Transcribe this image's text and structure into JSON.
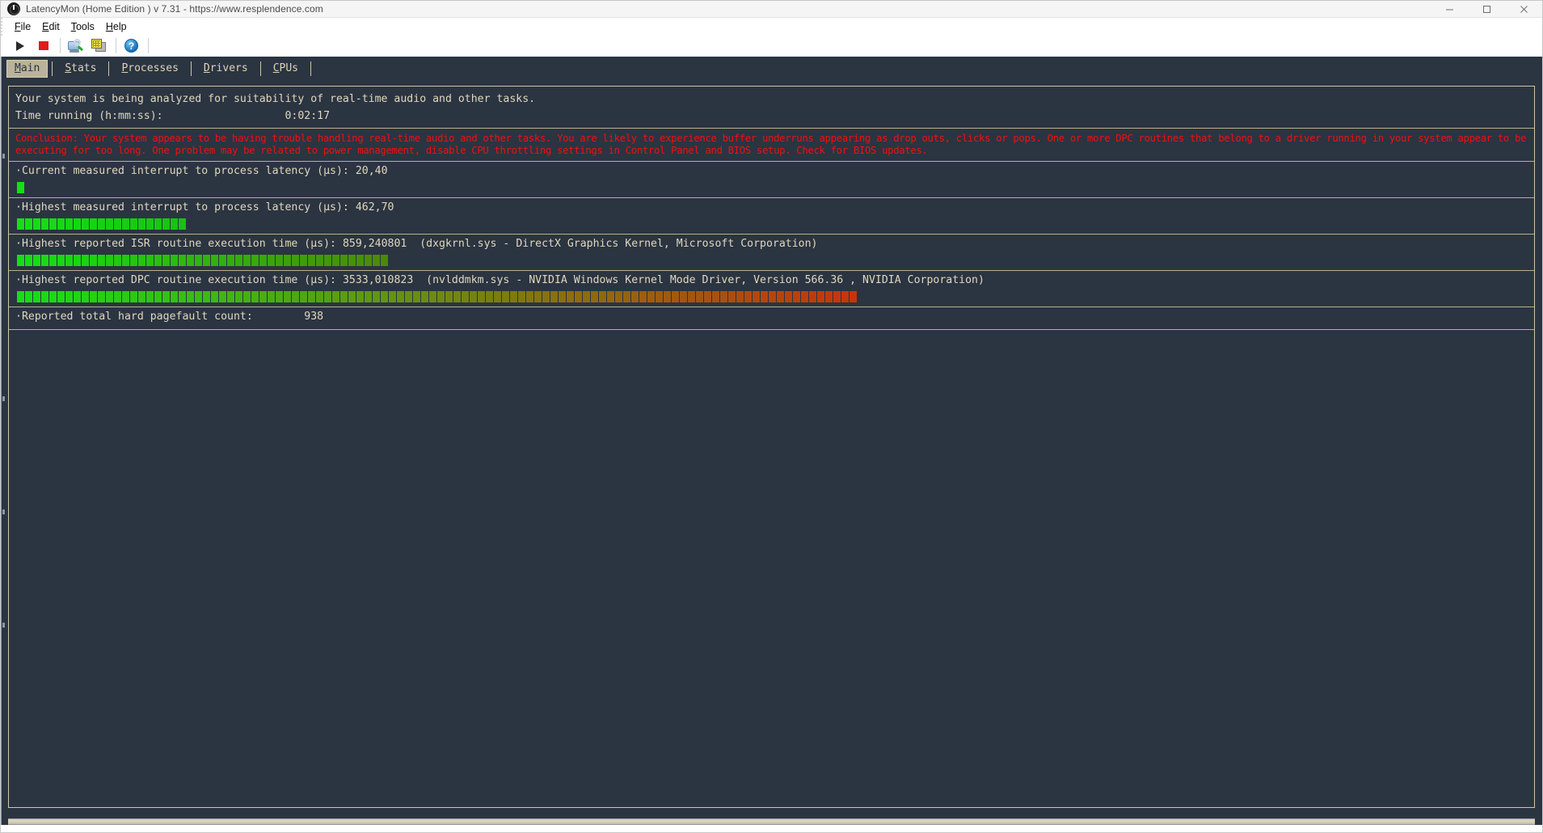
{
  "window": {
    "title": "LatencyMon  (Home Edition )  v 7.31 - https://www.resplendence.com",
    "icon": "latencymon-app-icon",
    "controls": {
      "minimize": "minimize-icon",
      "maximize": "maximize-icon",
      "close": "close-icon"
    }
  },
  "menubar": {
    "items": [
      {
        "label": "File",
        "mnemonic": "F"
      },
      {
        "label": "Edit",
        "mnemonic": "E"
      },
      {
        "label": "Tools",
        "mnemonic": "T"
      },
      {
        "label": "Help",
        "mnemonic": "H"
      }
    ]
  },
  "toolbar": {
    "buttons": [
      {
        "name": "start-monitoring-button",
        "icon": "play-icon",
        "tooltip": "Start monitoring"
      },
      {
        "name": "stop-monitoring-button",
        "icon": "stop-icon",
        "tooltip": "Stop monitoring"
      },
      {
        "name": "report-button",
        "icon": "report-icon",
        "tooltip": "Report"
      },
      {
        "name": "copy-button",
        "icon": "copy-icon",
        "tooltip": "Copy"
      },
      {
        "name": "help-button",
        "icon": "help-icon",
        "glyph": "?",
        "tooltip": "Help"
      }
    ]
  },
  "tabs": [
    {
      "label": "Main",
      "mnemonic": "M",
      "active": true
    },
    {
      "label": "Stats",
      "mnemonic": "S",
      "active": false
    },
    {
      "label": "Processes",
      "mnemonic": "P",
      "active": false
    },
    {
      "label": "Drivers",
      "mnemonic": "D",
      "active": false
    },
    {
      "label": "CPUs",
      "mnemonic": "C",
      "active": false
    }
  ],
  "main": {
    "status_line": "Your system is being analyzed for suitability of real-time audio and other tasks.",
    "time_running_label": "Time running (h:mm:ss):",
    "time_running_value": "0:02:17",
    "conclusion": "Conclusion: Your system appears to be having trouble handling real-time audio and other tasks. You are likely to experience buffer underruns appearing as drop outs, clicks or pops. One or more DPC routines that belong to a driver running in your system appear to be executing for too long. One problem may be related to power management, disable CPU throttling settings in Control Panel and BIOS setup. Check for BIOS updates.",
    "conclusion_color": "#f01010",
    "metrics": [
      {
        "name": "current-interrupt-to-process-latency",
        "label": "Current measured interrupt to process latency (µs):",
        "value": "20,40",
        "extra": "",
        "bar_segments": 1,
        "bar_start_color": "#14e014",
        "bar_end_color": "#14e014"
      },
      {
        "name": "highest-interrupt-to-process-latency",
        "label": "Highest measured interrupt to process latency (µs):",
        "value": "462,70",
        "extra": "",
        "bar_segments": 21,
        "bar_start_color": "#14e014",
        "bar_end_color": "#18c212"
      },
      {
        "name": "highest-isr-routine-execution-time",
        "label": "Highest reported ISR routine execution time (µs):",
        "value": "859,240801",
        "extra": "(dxgkrnl.sys - DirectX Graphics Kernel, Microsoft Corporation)",
        "bar_segments": 46,
        "bar_start_color": "#14e014",
        "bar_end_color": "#4a8a08"
      },
      {
        "name": "highest-dpc-routine-execution-time",
        "label": "Highest reported DPC routine execution time (µs):",
        "value": "3533,010823",
        "extra": "(nvlddmkm.sys - NVIDIA Windows Kernel Mode Driver, Version 566.36 , NVIDIA Corporation)",
        "bar_segments": 104,
        "bar_start_color": "#14e014",
        "bar_end_color": "#c8340a"
      },
      {
        "name": "reported-total-hard-pagefault-count",
        "label": "Reported total hard pagefault count:",
        "value": "938",
        "extra": "",
        "bar_segments": 0,
        "bar_start_color": "#14e014",
        "bar_end_color": "#14e014"
      }
    ]
  },
  "theme": {
    "app_background": "#2b3441",
    "mono_text": "#e0d8bf",
    "border": "#cfc6ab",
    "title_text": "#4b4b4b"
  }
}
